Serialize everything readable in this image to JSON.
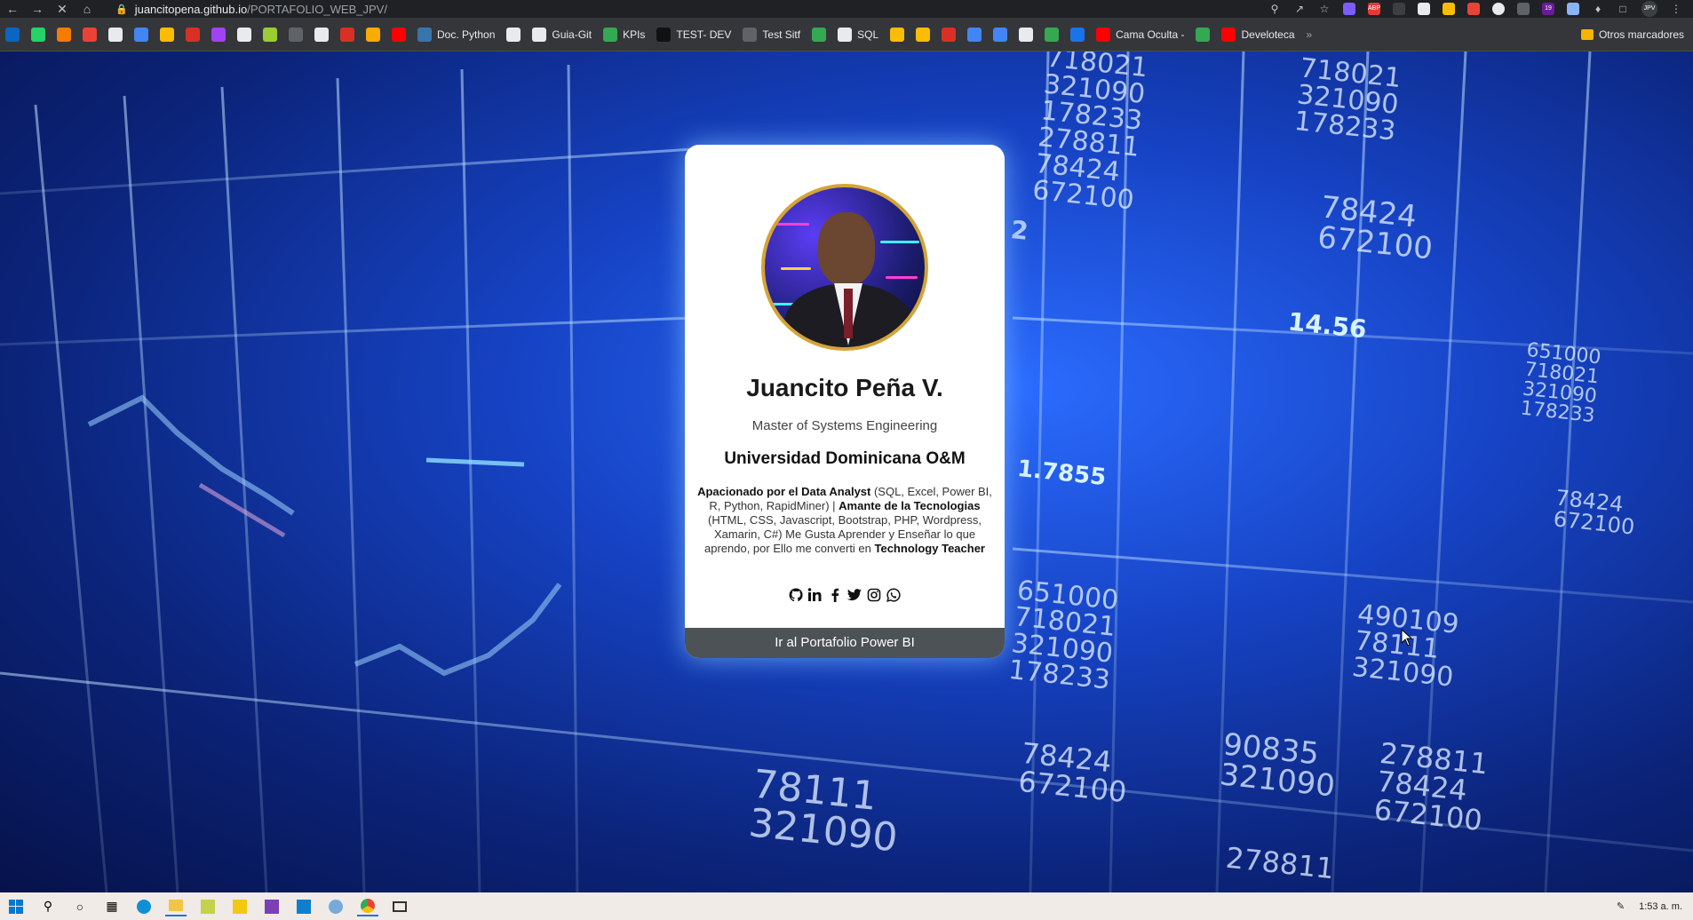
{
  "browser": {
    "url_host": "juancitopena.github.io",
    "url_path": "/PORTAFOLIO_WEB_JPV/",
    "profile": "JPV",
    "ext_badge": "19",
    "bookmarks": [
      {
        "label": "",
        "color": "#0a66c2"
      },
      {
        "label": "",
        "color": "#25d366"
      },
      {
        "label": "",
        "color": "#f57c00"
      },
      {
        "label": "",
        "color": "#ea4335"
      },
      {
        "label": "",
        "color": "#e8eaed"
      },
      {
        "label": "",
        "color": "#4285f4"
      },
      {
        "label": "",
        "color": "#fbbc04"
      },
      {
        "label": "",
        "color": "#d93025"
      },
      {
        "label": "",
        "color": "#a142f4"
      },
      {
        "label": "",
        "color": "#e8eaed"
      },
      {
        "label": "",
        "color": "#9acd32"
      },
      {
        "label": "",
        "color": "#5f6368"
      },
      {
        "label": "",
        "color": "#e8eaed"
      },
      {
        "label": "",
        "color": "#d93025"
      },
      {
        "label": "",
        "color": "#f9ab00"
      },
      {
        "label": "",
        "color": "#ff0000"
      },
      {
        "label": "Doc. Python",
        "color": "#3776ab"
      },
      {
        "label": "",
        "color": "#e8eaed"
      },
      {
        "label": "Guia-Git",
        "color": "#e8eaed"
      },
      {
        "label": "KPIs",
        "color": "#34a853"
      },
      {
        "label": "TEST- DEV",
        "color": "#111111"
      },
      {
        "label": "Test Sitf",
        "color": "#5f6368"
      },
      {
        "label": "",
        "color": "#34a853"
      },
      {
        "label": "SQL",
        "color": "#e8eaed"
      },
      {
        "label": "",
        "color": "#fbbc04"
      },
      {
        "label": "",
        "color": "#fbbc04"
      },
      {
        "label": "",
        "color": "#d93025"
      },
      {
        "label": "",
        "color": "#4285f4"
      },
      {
        "label": "",
        "color": "#4285f4"
      },
      {
        "label": "",
        "color": "#e8eaed"
      },
      {
        "label": "",
        "color": "#34a853"
      },
      {
        "label": "",
        "color": "#1a73e8"
      },
      {
        "label": "Cama Oculta -",
        "color": "#ff0000"
      },
      {
        "label": "",
        "color": "#34a853"
      },
      {
        "label": "Develoteca",
        "color": "#ff0000"
      }
    ],
    "other_bookmarks": "Otros marcadores"
  },
  "background_numbers": [
    "718021\n321090\n178233\n278811\n78424\n672100",
    "718021\n321090\n178233",
    "78424\n672100",
    "14.56",
    "1.7855",
    "651000\n718021\n321090\n178233",
    "78424\n672100",
    "490109\n78111\n321090",
    "78111\n321090",
    "90835\n321090",
    "278811\n78424\n672100",
    "278811",
    "651000\n718021\n321090\n178233",
    "78424\n672100",
    "2"
  ],
  "profile": {
    "name": "Juancito Peña V.",
    "degree": "Master of Systems Engineering",
    "university": "Universidad Dominicana O&M",
    "bio_bold_1": "Apacionado por el Data Analyst",
    "bio_text_1": " (SQL, Excel, Power BI, R, Python, RapidMiner) | ",
    "bio_bold_2": "Amante de la Tecnologias",
    "bio_text_2": " (HTML, CSS, Javascript, Bootstrap, PHP, Wordpress, Xamarin, C#) Me Gusta Aprender y Enseñar lo que aprendo, por Ello me converti en ",
    "bio_bold_3": "Technology Teacher",
    "socials": [
      "github-icon",
      "linkedin-icon",
      "facebook-icon",
      "twitter-icon",
      "instagram-icon",
      "whatsapp-icon"
    ],
    "cta": "Ir al Portafolio Power BI"
  },
  "taskbar": {
    "time": "1:53 a. m."
  }
}
